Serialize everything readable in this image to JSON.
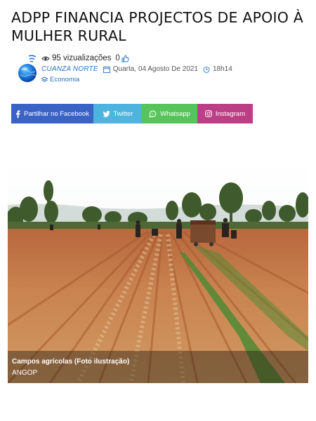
{
  "article": {
    "title": "ADPP FINANCIA PROJECTOS DE APOIO À MULHER RURAL"
  },
  "meta": {
    "views": "95 vizualizações",
    "likes": "0",
    "author": "CUANZA NORTE",
    "date": "Quarta, 04 Agosto De 2021",
    "time": "18h14",
    "category": "Economia"
  },
  "share": {
    "facebook": "Partilhar no Facebook",
    "twitter": "Twitter",
    "whatsapp": "Whatsapp",
    "instagram": "Instagram"
  },
  "figure": {
    "caption": "Campos agrícolas (Foto ilustração)",
    "credit": "ANGOP"
  },
  "colors": {
    "facebook": "#3b63c6",
    "twitter": "#4fb3e0",
    "whatsapp": "#57c45b",
    "instagram": "#bc3f86",
    "accent": "#2a73c4"
  },
  "icons": [
    "eye-icon",
    "thumbs-up-icon",
    "calendar-icon",
    "clock-icon",
    "layers-icon",
    "facebook-icon",
    "twitter-icon",
    "whatsapp-icon",
    "instagram-icon"
  ]
}
